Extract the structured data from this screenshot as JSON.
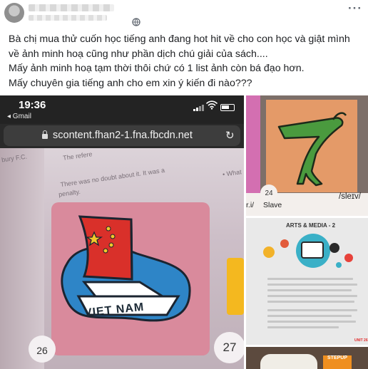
{
  "post": {
    "text_lines": [
      "Bà chị mua thử cuốn học tiếng anh đang hot hit về cho con học và giật mình",
      "về ảnh minh hoạ cũng như phần dịch chú giải của sách....",
      "Mấy ảnh minh hoạ tạm thời thôi chứ có 1 list ảnh còn bá đạo hơn.",
      "Mấy chuyên gia tiếng anh cho em xin ý kiến đi nào???"
    ],
    "privacy_icon": "globe-icon",
    "more_icon": "more-options-icon"
  },
  "photo1": {
    "time": "19:36",
    "back_app": "◂ Gmail",
    "url": "scontent.fhan2-1.fna.fbcdn.net",
    "book_text_1": "There was no doubt about it. It was a",
    "book_text_2": "penalty.",
    "book_text_3": "The refere",
    "book_text_4": "bury F.C.",
    "book_text_5": "• What",
    "flag_label": "VIET NAM",
    "page_left": "26",
    "page_right": "27"
  },
  "photo2": {
    "page_number": "24",
    "word": "Slave",
    "prefix": "r.i/",
    "ipa": "/sleɪv/"
  },
  "photo3": {
    "title": "ARTS & MEDIA - 2",
    "unit": "UNIT 26"
  },
  "photo4": {
    "label": "STEPUP"
  },
  "colors": {
    "text": "#1c1e21",
    "illustration_bg": "#d98a9c",
    "flag_red": "#d9302a",
    "sea_blue": "#2e85c7",
    "card_orange": "#e49a68",
    "hand_green": "#4a9a3e"
  }
}
